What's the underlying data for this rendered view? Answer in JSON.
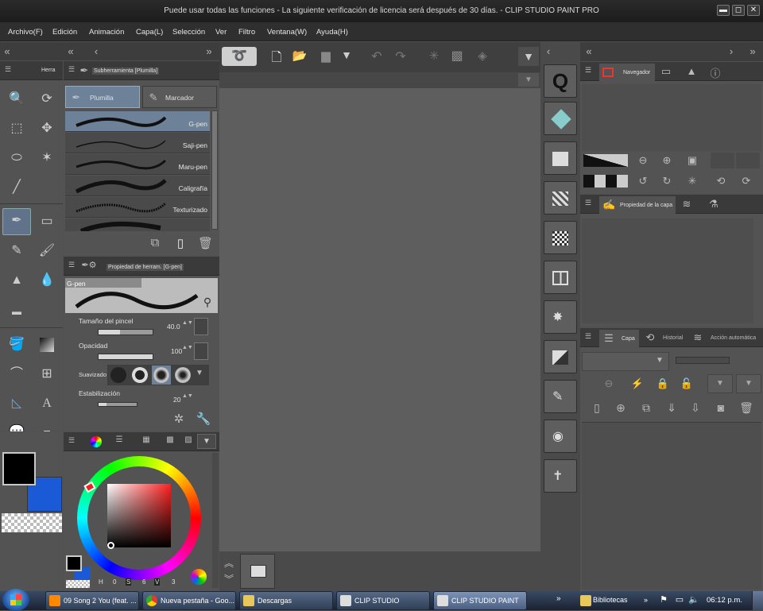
{
  "window": {
    "title": "Puede usar todas las funciones - La siguiente verificación de licencia será después de 30 días. - CLIP STUDIO PAINT PRO",
    "min": "▬",
    "max": "◻",
    "close": "✕"
  },
  "menu": [
    "Archivo(F)",
    "Edición",
    "Animación",
    "Capa(L)",
    "Selección",
    "Ver",
    "Filtro",
    "Ventana(W)",
    "Ayuda(H)"
  ],
  "tool_panel": {
    "tab": "Herra"
  },
  "subtool": {
    "tab": "Subherramienta [Plumilla]",
    "groups": [
      "Plumilla",
      "Marcador"
    ],
    "brushes": [
      "G-pen",
      "Saji-pen",
      "Maru-pen",
      "Caligrafía",
      "Texturizado"
    ]
  },
  "tool_property": {
    "tab": "Propiedad de herram. [G-pen]",
    "preview_label": "G-pen",
    "brush_size_label": "Tamaño del pincel",
    "brush_size": "40.0",
    "opacity_label": "Opacidad",
    "opacity": "100",
    "smoothing_label": "Suavizado",
    "stabilization_label": "Estabilización",
    "stabilization": "20",
    "brush_size_level": 0.4,
    "opacity_level": 1.0,
    "stabilization_level": 0.2
  },
  "colors": {
    "main": "#000000",
    "sub": "#1a5ad6",
    "wheel_values": [
      "H",
      "0",
      "S",
      "6",
      "V",
      "3"
    ]
  },
  "right_panels": {
    "navigator_tab": "Navegador",
    "layer_property_tab": "Propiedad de la capa",
    "layer_tab": "Capa",
    "history_tab": "Historial",
    "auto_action_tab": "Acción automática"
  },
  "taskbar": {
    "items": [
      "09 Song 2 You  (feat. ...",
      "Nueva pestaña - Goo...",
      "Descargas",
      "CLIP STUDIO",
      "CLIP STUDIO PAINT"
    ],
    "libraries": "Bibliotecas",
    "clock": "06:12 p.m.",
    "more": "»"
  }
}
